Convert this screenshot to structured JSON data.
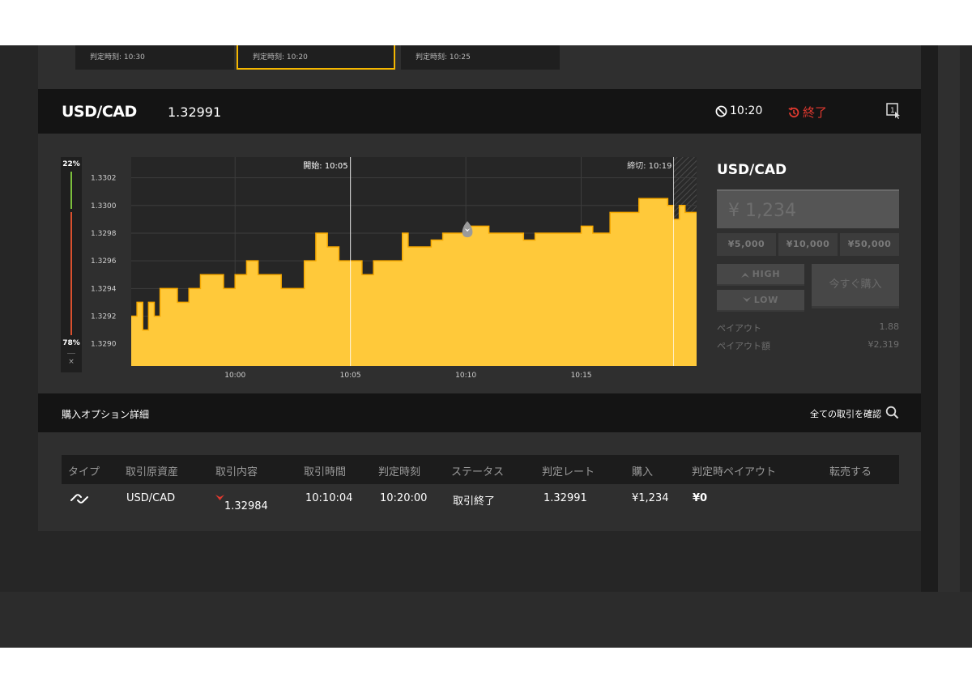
{
  "option_tabs": [
    {
      "label": "判定時刻: 10:30"
    },
    {
      "label": "判定時刻: 10:20"
    },
    {
      "label": "判定時刻: 10:25"
    }
  ],
  "header": {
    "symbol": "USD/CAD",
    "rate": "1.32991",
    "timer": "10:20",
    "status": "終了"
  },
  "ratio": {
    "high_pct": "22%",
    "low_pct": "78%",
    "close": "×"
  },
  "chart_data": {
    "type": "area",
    "title": "",
    "xlabel": "",
    "ylabel": "",
    "x_ticks": [
      "10:00",
      "10:05",
      "10:10",
      "10:15"
    ],
    "y_ticks": [
      "1.3302",
      "1.3300",
      "1.3298",
      "1.3296",
      "1.3294",
      "1.3292",
      "1.3290"
    ],
    "ylim": [
      1.32884,
      1.33035
    ],
    "xlim": [
      "09:55:30",
      "10:20:00"
    ],
    "grid": true,
    "color": "#ffc93a",
    "line_color": "#f5a800",
    "start_label": "開始: 10:05",
    "start_time": "10:05:00",
    "close_label": "締切: 10:19",
    "close_time": "10:19:00",
    "marker_time": "10:10:04",
    "marker_value": 1.32984,
    "series": [
      {
        "x": [
          "09:55:30",
          "09:55:45",
          "09:56:00",
          "09:56:15",
          "09:56:30",
          "09:56:45",
          "09:57:00",
          "09:57:30",
          "09:58:00",
          "09:58:30",
          "09:59:00",
          "09:59:30",
          "10:00:00",
          "10:00:30",
          "10:01:00",
          "10:01:30",
          "10:02:00",
          "10:02:30",
          "10:03:00",
          "10:03:15",
          "10:03:30",
          "10:04:00",
          "10:04:30",
          "10:05:00",
          "10:05:30",
          "10:06:00",
          "10:06:30",
          "10:07:00",
          "10:07:15",
          "10:07:30",
          "10:08:00",
          "10:08:30",
          "10:09:00",
          "10:09:30",
          "10:10:00",
          "10:10:30",
          "10:11:00",
          "10:11:30",
          "10:12:00",
          "10:12:30",
          "10:13:00",
          "10:13:30",
          "10:14:00",
          "10:14:30",
          "10:15:00",
          "10:15:30",
          "10:16:00",
          "10:16:15",
          "10:16:30",
          "10:17:00",
          "10:17:30",
          "10:18:00",
          "10:18:30",
          "10:18:45",
          "10:19:00",
          "10:19:15",
          "10:19:30",
          "10:20:00"
        ],
        "values": [
          1.3292,
          1.3293,
          1.3291,
          1.3293,
          1.3292,
          1.3294,
          1.3294,
          1.3293,
          1.3294,
          1.3295,
          1.3295,
          1.3294,
          1.3295,
          1.3296,
          1.3295,
          1.3295,
          1.3294,
          1.3294,
          1.3296,
          1.3296,
          1.3298,
          1.3297,
          1.3296,
          1.3296,
          1.3295,
          1.3296,
          1.3296,
          1.3296,
          1.3298,
          1.3297,
          1.3297,
          1.32975,
          1.3298,
          1.3298,
          1.32985,
          1.32985,
          1.3298,
          1.3298,
          1.3298,
          1.32975,
          1.3298,
          1.3298,
          1.3298,
          1.3298,
          1.32985,
          1.3298,
          1.3298,
          1.32995,
          1.32995,
          1.32995,
          1.33005,
          1.33005,
          1.33005,
          1.33,
          1.3299,
          1.33,
          1.32995,
          1.32995
        ]
      }
    ]
  },
  "trade_panel": {
    "title": "USD/CAD",
    "amount": "¥ 1,234",
    "presets": [
      "¥5,000",
      "¥10,000",
      "¥50,000"
    ],
    "high_label": "HIGH",
    "low_label": "LOW",
    "buy_label": "今すぐ購入",
    "payout_label": "ペイアウト",
    "payout_value": "1.88",
    "payout_amount_label": "ペイアウト額",
    "payout_amount_value": "¥2,319"
  },
  "details": {
    "title": "購入オプション詳細",
    "view_all": "全ての取引を確認",
    "columns": [
      "タイプ",
      "取引原資産",
      "取引内容",
      "取引時間",
      "判定時刻",
      "ステータス",
      "判定レート",
      "購入",
      "判定時ペイアウト",
      "転売する"
    ],
    "row": {
      "asset": "USD/CAD",
      "content": "1.32984",
      "trade_time": "10:10:04",
      "judge_time": "10:20:00",
      "status": "取引終了",
      "judge_rate": "1.32991",
      "purchase": "¥1,234",
      "payout": "¥0"
    }
  },
  "colors": {
    "accent": "#f5b700",
    "ended": "#e0392f",
    "high": "#7cbf3c",
    "low": "#d9502e"
  }
}
